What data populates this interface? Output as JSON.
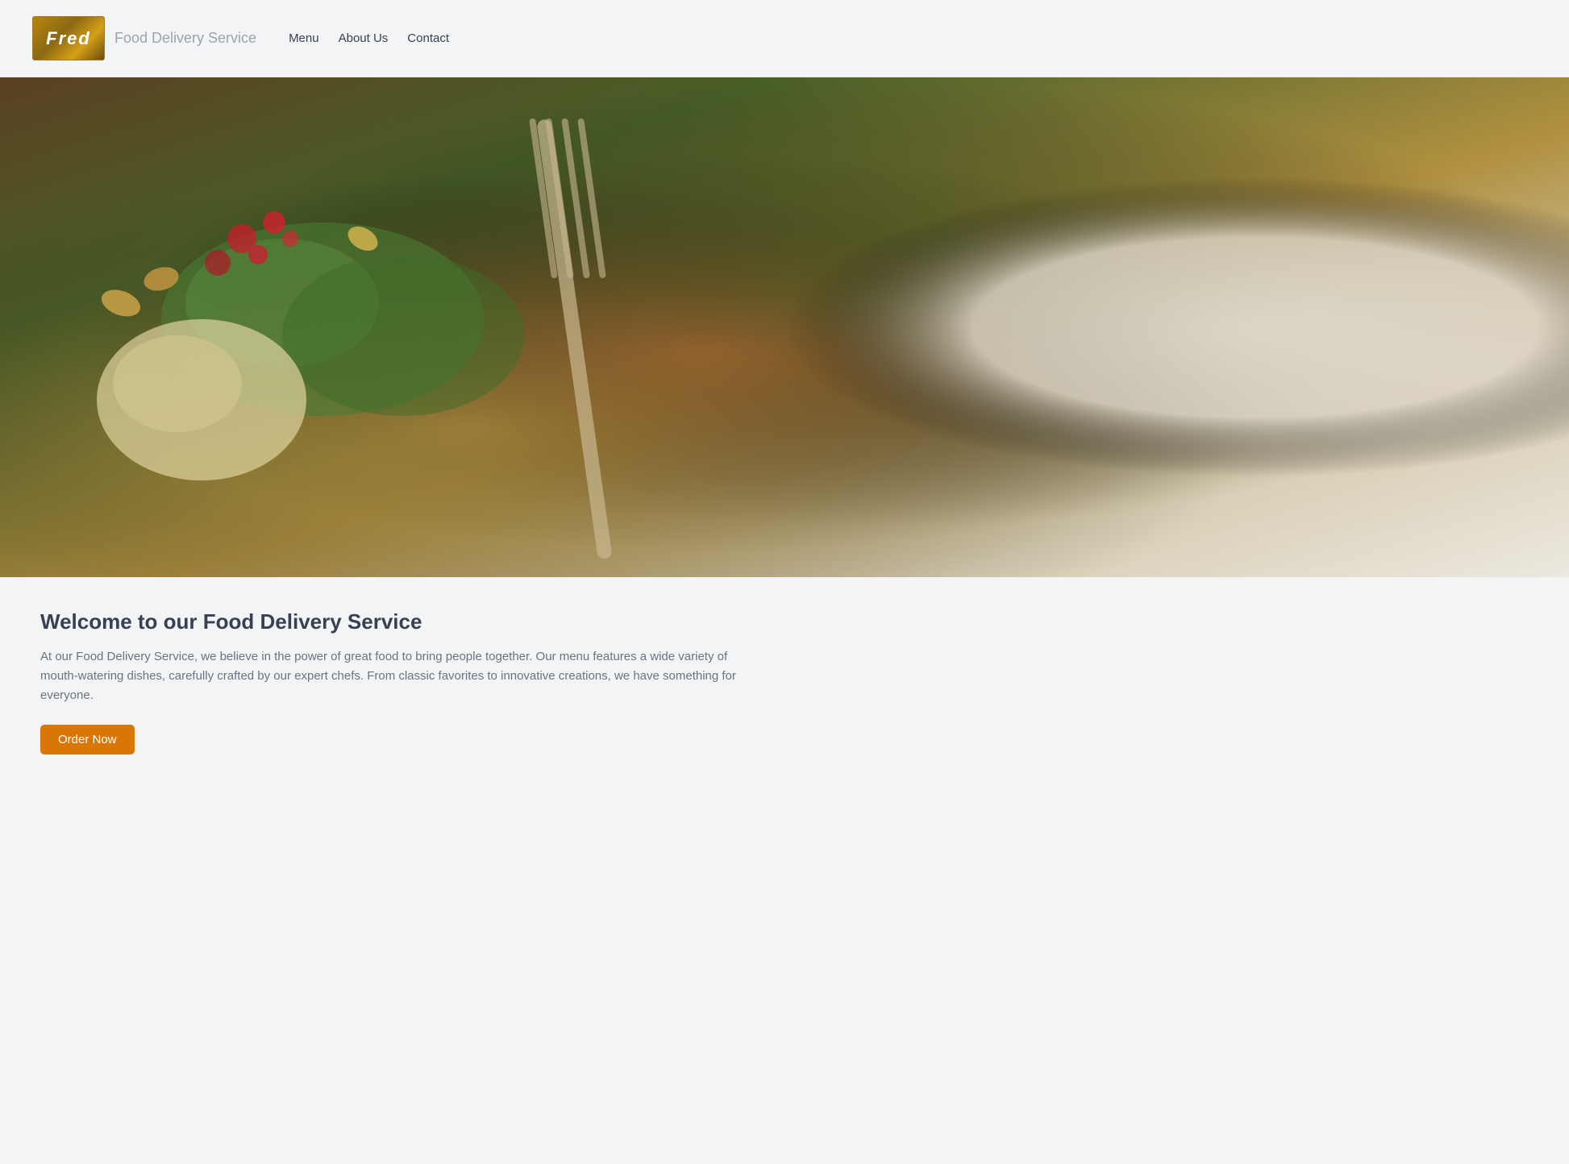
{
  "header": {
    "logo_text": "Fred",
    "site_title": "Food Delivery Service",
    "nav_items": [
      {
        "label": "Menu",
        "href": "#menu"
      },
      {
        "label": "About Us",
        "href": "#about"
      },
      {
        "label": "Contact",
        "href": "#contact"
      }
    ]
  },
  "hero": {
    "alt": "A colorful gourmet food dish with greens, cauliflower, pomegranate and a fork on a white plate"
  },
  "main": {
    "welcome_title": "Welcome to our Food Delivery Service",
    "welcome_text": "At our Food Delivery Service, we believe in the power of great food to bring people together. Our menu features a wide variety of mouth-watering dishes, carefully crafted by our expert chefs. From classic favorites to innovative creations, we have something for everyone.",
    "order_button_label": "Order Now"
  }
}
